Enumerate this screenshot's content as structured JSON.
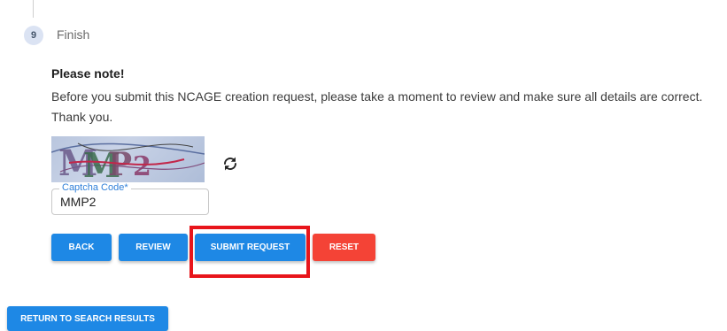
{
  "step": {
    "number": "9",
    "title": "Finish"
  },
  "note": {
    "heading": "Please note!",
    "text": "Before you submit this NCAGE creation request, please take a moment to review and make sure all details are correct. Thank you."
  },
  "captcha": {
    "image_text": "MMP2",
    "field_label": "Captcha Code*",
    "field_value": "MMP2"
  },
  "buttons": {
    "back": "BACK",
    "review": "REVIEW",
    "submit": "SUBMIT REQUEST",
    "reset": "RESET",
    "return_to_results": "RETURN TO SEARCH RESULTS"
  },
  "colors": {
    "primary": "#1e88e5",
    "danger": "#f44336",
    "highlight": "#e8151b",
    "step_circle": "#dbe3f3"
  },
  "icons": {
    "refresh": "refresh-icon"
  }
}
